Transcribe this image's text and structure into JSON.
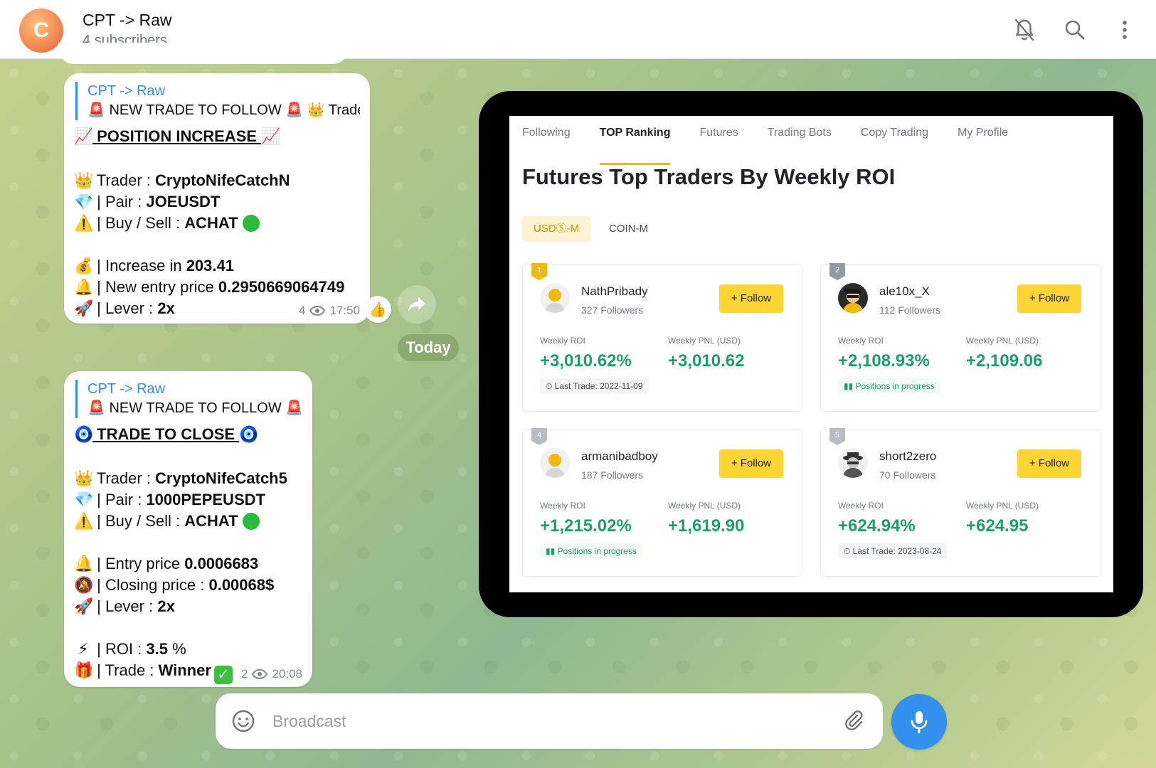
{
  "header": {
    "title": "CPT -> Raw",
    "subtitle": "4 subscribers",
    "icons": [
      "bell-off-icon",
      "search-icon",
      "more-vertical-icon"
    ]
  },
  "messages": [
    {
      "reply_name": "CPT -> Raw",
      "reply_text": "NEW TRADE TO FOLLOW 🚨 👑 Trade...",
      "headline": "POSITION INCREASE",
      "lines": [
        {
          "label": "Trader : ",
          "value": "CryptoNifeCatchN"
        },
        {
          "label": "| Pair : ",
          "value": "JOEUSDT"
        },
        {
          "label": "| Buy / Sell : ",
          "value": "ACHAT"
        },
        {
          "label": "| Increase in ",
          "value": "203.41"
        },
        {
          "label": "| New entry price ",
          "value": "0.2950669064749"
        },
        {
          "label": "| Lever : ",
          "value": "2x"
        }
      ],
      "views": "4",
      "time": "17:50",
      "reaction": "👍"
    },
    {
      "reply_name": "CPT -> Raw",
      "reply_text": "NEW TRADE TO FOLLOW 🚨 ...",
      "headline": "TRADE TO CLOSE",
      "lines": [
        {
          "label": "Trader : ",
          "value": "CryptoNifeCatch5"
        },
        {
          "label": "| Pair : ",
          "value": "1000PEPEUSDT"
        },
        {
          "label": "| Buy / Sell : ",
          "value": "ACHAT"
        },
        {
          "label": "| Entry price ",
          "value": "0.0006683"
        },
        {
          "label": "| Closing price : ",
          "value": "0.00068$"
        },
        {
          "label": "| Lever : ",
          "value": "2x"
        },
        {
          "label": "| ROI : ",
          "value": "3.5",
          "suffix": " %"
        },
        {
          "label": "| Trade : ",
          "value": "Winner"
        }
      ],
      "views": "2",
      "time": "20:08"
    }
  ],
  "date_separator": "Today",
  "embedded": {
    "tabs": [
      "Following",
      "TOP Ranking",
      "Futures",
      "Trading Bots",
      "Copy Trading",
      "My Profile"
    ],
    "active_tab": "TOP Ranking",
    "title": "Futures Top Traders By Weekly ROI",
    "segments": [
      "USDⓈ-M",
      "COIN-M"
    ],
    "roi_label": "Weekly ROI",
    "pnl_label": "Weekly PNL (USD)",
    "follow_label": "+ Follow",
    "traders": [
      {
        "rank": "1",
        "name": "NathPribady",
        "followers": "327 Followers",
        "roi": "+3,010.62%",
        "pnl": "+3,010.62",
        "tag": "Last Trade: 2022-11-09",
        "tag_type": "last",
        "rank_color": "#f0b90b"
      },
      {
        "rank": "2",
        "name": "ale10x_X",
        "followers": "112 Followers",
        "roi": "+2,108.93%",
        "pnl": "+2,109.06",
        "tag": "Positions in progress",
        "tag_type": "pos",
        "rank_color": "#929aa5"
      },
      {
        "rank": "4",
        "name": "armanibadboy",
        "followers": "187 Followers",
        "roi": "+1,215.02%",
        "pnl": "+1,619.90",
        "tag": "Positions in progress",
        "tag_type": "pos",
        "rank_color": "#b7bdc6"
      },
      {
        "rank": "5",
        "name": "short2zero",
        "followers": "70 Followers",
        "roi": "+624.94%",
        "pnl": "+624.95",
        "tag": "Last Trade: 2023-08-24",
        "tag_type": "last",
        "rank_color": "#b7bdc6"
      }
    ]
  },
  "composer": {
    "placeholder": "Broadcast"
  },
  "colors": {
    "accent": "#3390ec",
    "binance_yellow": "#fcd535",
    "profit_green": "#1e9e6a"
  }
}
